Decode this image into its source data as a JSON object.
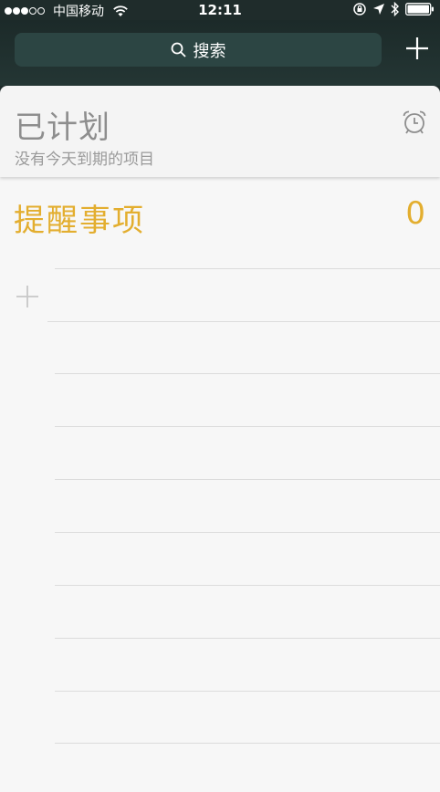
{
  "status_bar": {
    "carrier": "中国移动",
    "time": "12:11"
  },
  "search": {
    "label": "搜索"
  },
  "scheduled": {
    "title": "已计划",
    "subtitle": "没有今天到期的项目"
  },
  "reminders": {
    "title": "提醒事项",
    "count": "0"
  },
  "colors": {
    "accent": "#e3ae2f",
    "nav_bg": "#1f2c2b"
  },
  "icons": [
    "wifi-icon",
    "orientation-lock-icon",
    "location-icon",
    "bluetooth-icon",
    "battery-icon",
    "search-icon",
    "plus-icon",
    "alarm-clock-icon"
  ]
}
